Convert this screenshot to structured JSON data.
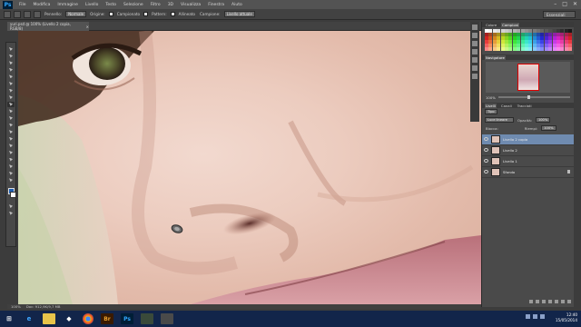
{
  "menu": {
    "items": [
      "File",
      "Modifica",
      "Immagine",
      "Livello",
      "Testo",
      "Selezione",
      "Filtro",
      "3D",
      "Visualizza",
      "Finestra",
      "Aiuto"
    ]
  },
  "options": {
    "pennello_label": "Pennello:",
    "mode_value": "Normale",
    "origine_label": "Origine:",
    "campionato_label": "Campionato",
    "pattern_label": "Pattern:",
    "allineato_label": "Allineato",
    "campione_label": "Campione:",
    "campione_value": "Livello attuale",
    "workspace": "Essenziali"
  },
  "document": {
    "tab_title": "yuri.psd @ 100% (Livello 2 copia, RGB/8)",
    "zoom": "100%",
    "doc_size": "Doc: 912,9K/9,7 MB"
  },
  "panels": {
    "color_tabs": [
      "Colore",
      "Campioni"
    ],
    "navigator_tab": "Navigatore",
    "nav_zoom": "100%",
    "layer_tabs": [
      "Livelli",
      "Canali",
      "Tracciati"
    ],
    "kind_label": "Tipo",
    "blend_mode": "Luce lineare",
    "opacity_label": "Opacità:",
    "opacity_value": "100%",
    "lock_label": "Blocca:",
    "fill_label": "Riempi:",
    "fill_value": "100%",
    "layers": [
      {
        "name": "Livello 2 copia",
        "selected": true
      },
      {
        "name": "Livello 2",
        "selected": false
      },
      {
        "name": "Livello 1",
        "selected": false
      },
      {
        "name": "Sfondo",
        "selected": false
      }
    ]
  },
  "taskbar": {
    "time": "12:40",
    "date": "15/05/2014"
  },
  "colors": {
    "selection": "#6f8bb0",
    "foreground": "#1e5fb4",
    "background": "#ffffff",
    "taskbar": "#12254a"
  }
}
